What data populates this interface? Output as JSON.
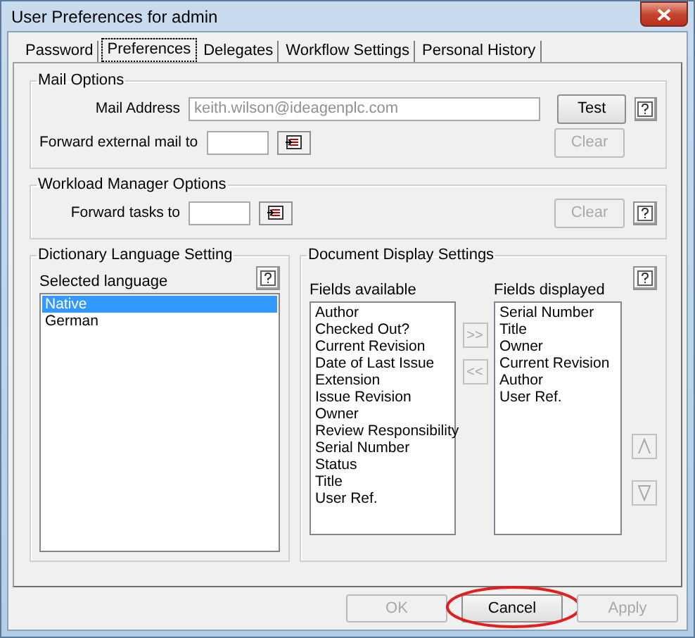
{
  "window": {
    "title": "User Preferences for admin"
  },
  "tabs": [
    {
      "label": "Password",
      "selected": false
    },
    {
      "label": "Preferences",
      "selected": true
    },
    {
      "label": "Delegates",
      "selected": false
    },
    {
      "label": "Workflow Settings",
      "selected": false
    },
    {
      "label": "Personal History",
      "selected": false
    }
  ],
  "mail_options": {
    "title": "Mail Options",
    "mail_address": {
      "label": "Mail Address",
      "value": "keith.wilson@ideagenplc.com",
      "disabled": true
    },
    "test_button": {
      "label": "Test",
      "disabled": false
    },
    "forward_external": {
      "label": "Forward external mail to"
    },
    "clear_button": {
      "label": "Clear",
      "disabled": true
    }
  },
  "workload_options": {
    "title": "Workload Manager Options",
    "forward_tasks": {
      "label": "Forward tasks to"
    },
    "clear_button": {
      "label": "Clear",
      "disabled": true
    }
  },
  "dictionary": {
    "title": "Dictionary Language Setting",
    "label": "Selected language",
    "languages": [
      {
        "name": "Native",
        "selected": true
      },
      {
        "name": "German",
        "selected": false
      }
    ]
  },
  "display_settings": {
    "title": "Document Display Settings",
    "available_label": "Fields available",
    "available": [
      {
        "name": "Author",
        "selected": false
      },
      {
        "name": "Checked Out?",
        "selected": false
      },
      {
        "name": "Current Revision",
        "selected": false
      },
      {
        "name": "Date of Last Issue",
        "selected": false
      },
      {
        "name": "Extension",
        "selected": false
      },
      {
        "name": "Issue Revision",
        "selected": false
      },
      {
        "name": "Owner",
        "selected": false
      },
      {
        "name": "Review Responsibility",
        "selected": false
      },
      {
        "name": "Serial Number",
        "selected": false
      },
      {
        "name": "Status",
        "selected": false
      },
      {
        "name": "Title",
        "selected": false
      },
      {
        "name": "User Ref.",
        "selected": false
      }
    ],
    "displayed_label": "Fields displayed",
    "displayed": [
      {
        "name": "Serial Number",
        "selected": false
      },
      {
        "name": "Title",
        "selected": false
      },
      {
        "name": "Owner",
        "selected": false
      },
      {
        "name": "Current Revision",
        "selected": false
      },
      {
        "name": "Author",
        "selected": false
      },
      {
        "name": "User Ref.",
        "selected": false
      }
    ],
    "add_button": {
      "label": ">>",
      "disabled": true
    },
    "remove_button": {
      "label": "<<",
      "disabled": true
    },
    "move_up": {
      "disabled": true
    },
    "move_down": {
      "disabled": true
    }
  },
  "buttons": [
    {
      "label": "OK",
      "disabled": true,
      "circled": false
    },
    {
      "label": "Cancel",
      "disabled": false,
      "circled": true
    },
    {
      "label": "Apply",
      "disabled": true,
      "circled": false
    }
  ]
}
